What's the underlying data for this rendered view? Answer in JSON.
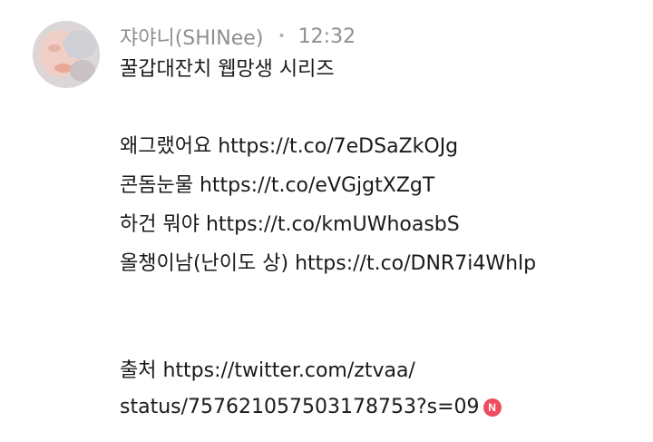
{
  "post": {
    "author": "쟈야니(SHINee)",
    "time": "12:32",
    "title": "꿀갑대잔치 웹망생 시리즈",
    "items": [
      {
        "label": "왜그랬어요",
        "url": "https://t.co/7eDSaZkOJg"
      },
      {
        "label": "콘돔눈물",
        "url": "https://t.co/eVGjgtXZgT"
      },
      {
        "label": "하건 뭐야",
        "url": "https://t.co/kmUWhoasbS"
      },
      {
        "label": "올챙이남(난이도 상)",
        "url": "https://t.co/DNR7i4Whlp"
      }
    ],
    "source_label": "출처",
    "source_url_line1": "https://twitter.com/ztvaa/",
    "source_url_line2": "status/757621057503178753?s=09",
    "badge": "N",
    "badge_color": "#ef4d5f"
  }
}
